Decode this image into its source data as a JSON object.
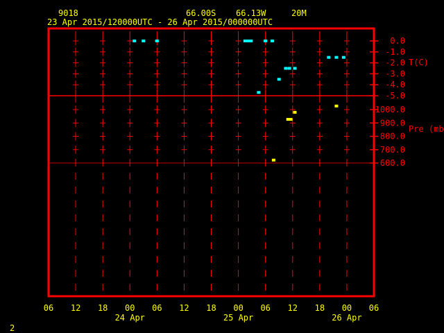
{
  "header": {
    "station": "9018",
    "latitude": "66.00S",
    "longitude": "66.13W",
    "elevation": "20M",
    "time_range": "23 Apr 2015/120000UTC - 26 Apr 2015/000000UTC"
  },
  "page_number": "2",
  "colors": {
    "axis": "#ff0000",
    "text_header": "#ffff00",
    "temperature": "#00ffff",
    "pressure": "#ffff00"
  },
  "chart_data": [
    {
      "type": "scatter",
      "title": "Temperature",
      "ylabel": "T(C)",
      "ylim": [
        -5,
        0
      ],
      "yticks": [
        "0.0",
        "-1.0",
        "-2.0",
        "-3.0",
        "-4.0",
        "-5.0"
      ],
      "x_hours_from_23Apr06": [
        19,
        21,
        24,
        43.5,
        44.2,
        44.8,
        48,
        49.5,
        52.5,
        53.3,
        54.5,
        51,
        46.5,
        62,
        63.7,
        65.3
      ],
      "values": [
        0,
        0,
        0,
        0,
        0,
        0,
        0,
        0,
        -2.5,
        -2.5,
        -2.5,
        -3.5,
        -4.7,
        -1.5,
        -1.5,
        -1.5
      ]
    },
    {
      "type": "scatter",
      "title": "Pressure",
      "ylabel": "Pre (mb)",
      "ylim": [
        600,
        1000
      ],
      "yticks": [
        "1000.0",
        "900.0",
        "800.0",
        "700.0",
        "600.0"
      ],
      "x_hours_from_23Apr06": [
        54.5,
        53,
        53.6,
        49.8,
        63.7
      ],
      "values": [
        980,
        927,
        927,
        622,
        1027
      ]
    }
  ],
  "x_axis": {
    "tick_labels": [
      "06",
      "12",
      "18",
      "00",
      "06",
      "12",
      "18",
      "00",
      "06",
      "12",
      "18",
      "00",
      "06"
    ],
    "date_labels": [
      "24 Apr",
      "25 Apr",
      "26 Apr"
    ]
  }
}
